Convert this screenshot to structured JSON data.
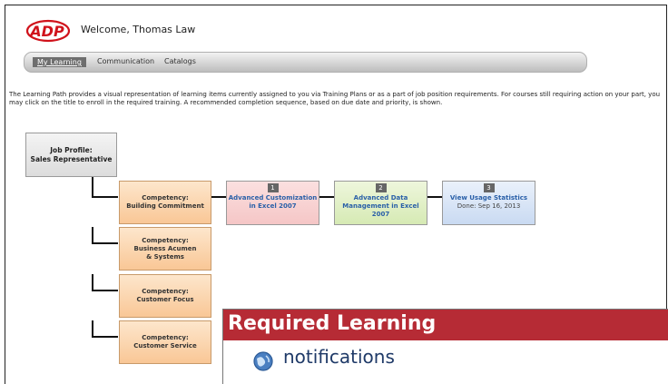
{
  "header": {
    "welcome": "Welcome, Thomas Law",
    "logo_text": "ADP"
  },
  "nav": {
    "items": [
      "My Learning",
      "Communication",
      "Catalogs"
    ]
  },
  "intro": "The Learning Path provides a visual representation of learning items currently assigned to you via Training Plans or as a part of job position requirements. For courses still requiring action on your part, you may click on the title to enroll in the  required training. A recommended completion sequence, based on due date and priority, is shown.",
  "job": {
    "label": "Job Profile:",
    "title": "Sales Representative"
  },
  "competencies": [
    {
      "label": "Competency:",
      "name": "Building Commitment"
    },
    {
      "label": "Competency:",
      "name": "Business Acumen & Systems"
    },
    {
      "label": "Competency:",
      "name": "Customer Focus"
    },
    {
      "label": "Competency:",
      "name": "Customer Service"
    }
  ],
  "courses": [
    {
      "num": "1",
      "title": "Advanced Customization in Excel 2007",
      "status": ""
    },
    {
      "num": "2",
      "title": "Advanced Data Management in Excel 2007",
      "status": ""
    },
    {
      "num": "3",
      "title": "View Usage Statistics",
      "status": "Done: Sep 16, 2013"
    }
  ],
  "overlay": {
    "title": "Required Learning",
    "notifications": "notifications"
  },
  "colors": {
    "brand_red": "#d0121b",
    "overlay_bar": "#b62b35",
    "link_blue": "#2a60a8"
  }
}
